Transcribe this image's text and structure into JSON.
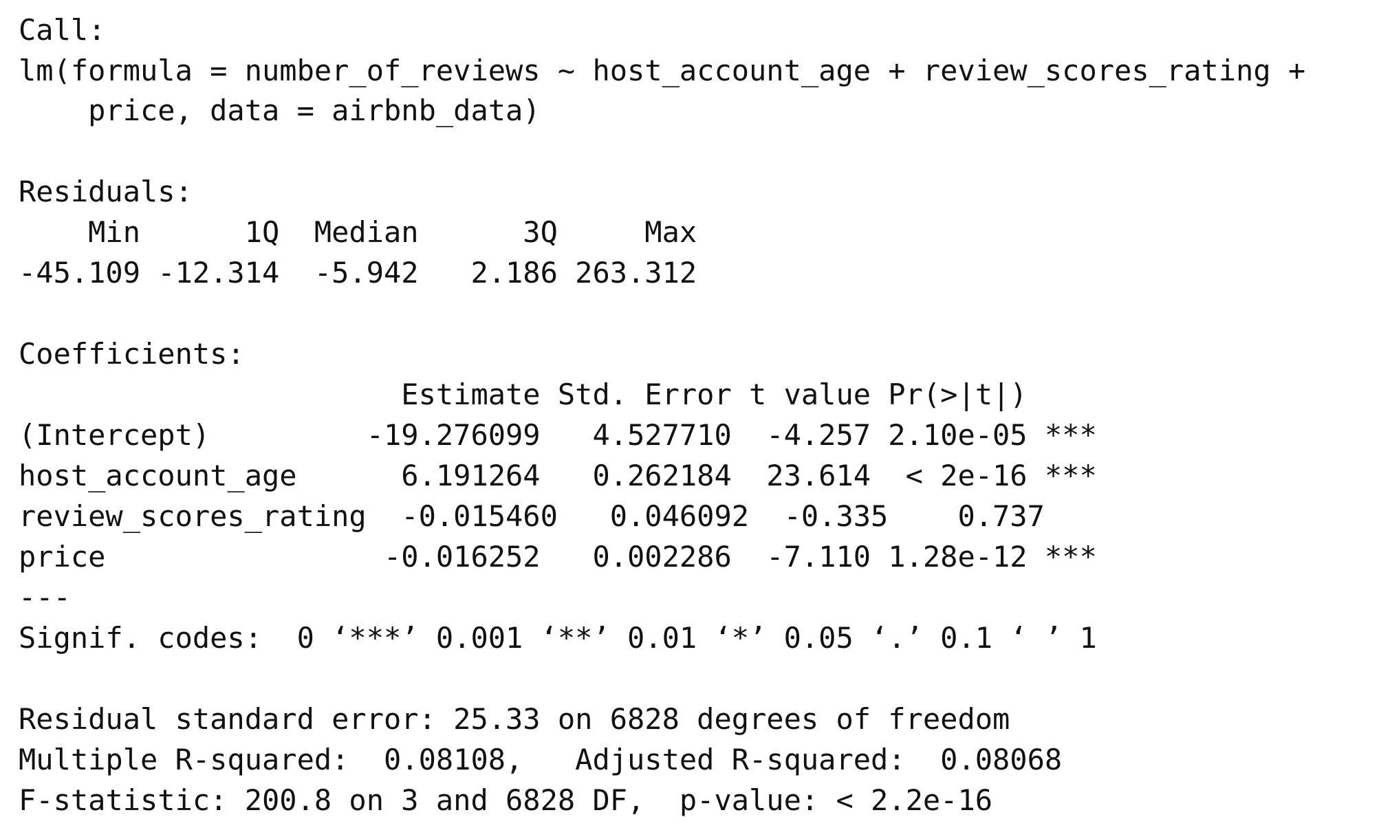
{
  "output": {
    "call_label": "Call:",
    "call_line1": "lm(formula = number_of_reviews ~ host_account_age + review_scores_rating +",
    "call_line2": "    price, data = airbnb_data)",
    "residuals_label": "Residuals:",
    "residuals_header": "    Min      1Q  Median      3Q     Max ",
    "residuals_values": "-45.109 -12.314  -5.942   2.186 263.312 ",
    "coefficients_label": "Coefficients:",
    "coef_header": "                      Estimate Std. Error t value Pr(>|t|)    ",
    "coef_row_intercept": "(Intercept)         -19.276099   4.527710  -4.257 2.10e-05 ***",
    "coef_row_host_account_age": "host_account_age      6.191264   0.262184  23.614  < 2e-16 ***",
    "coef_row_review_scores_rating": "review_scores_rating  -0.015460   0.046092  -0.335    0.737    ",
    "coef_row_price": "price                -0.016252   0.002286  -7.110 1.28e-12 ***",
    "separator": "---",
    "signif_codes": "Signif. codes:  0 ‘***’ 0.001 ‘**’ 0.01 ‘*’ 0.05 ‘.’ 0.1 ‘ ’ 1",
    "residual_se": "Residual standard error: 25.33 on 6828 degrees of freedom",
    "r_squared": "Multiple R-squared:  0.08108,\tAdjusted R-squared:  0.08068 ",
    "f_statistic": "F-statistic: 200.8 on 3 and 6828 DF,  p-value: < 2.2e-16"
  }
}
